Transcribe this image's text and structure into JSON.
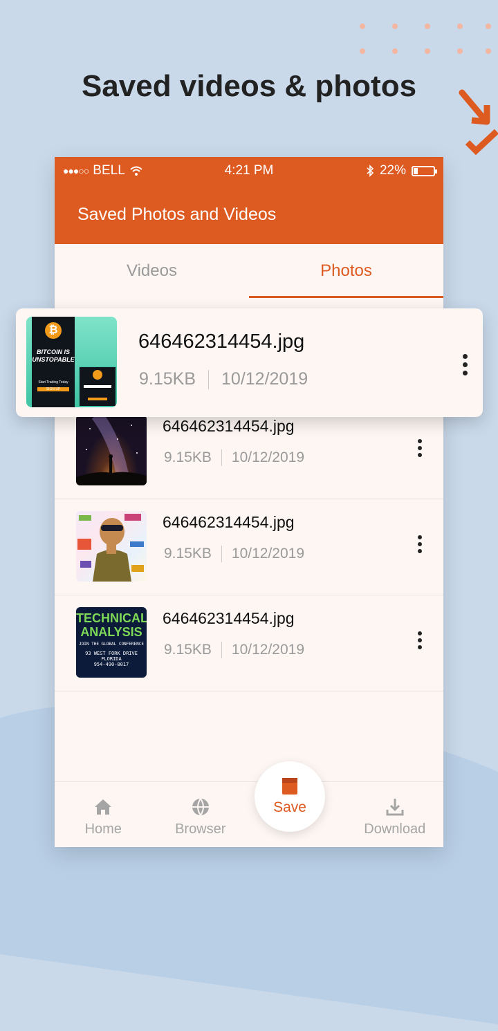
{
  "headline": "Saved videos & photos",
  "status_bar": {
    "carrier": "BELL",
    "time": "4:21 PM",
    "battery": "22%",
    "battery_level": 0.22
  },
  "app_bar": {
    "title": "Saved Photos and Videos"
  },
  "tabs": [
    {
      "label": "Videos",
      "active": false
    },
    {
      "label": "Photos",
      "active": true
    }
  ],
  "featured_item": {
    "filename": "646462314454.jpg",
    "size": "9.15KB",
    "date": "10/12/2019",
    "thumb_text": {
      "title": "BITCOIN IS UNSTOPABLE",
      "sub": "Start Trading Today",
      "btn": "SIGN UP"
    }
  },
  "items": [
    {
      "filename": "646462314454.jpg",
      "size": "9.15KB",
      "date": "10/12/2019",
      "thumb": "night-sky"
    },
    {
      "filename": "646462314454.jpg",
      "size": "9.15KB",
      "date": "10/12/2019",
      "thumb": "collage"
    },
    {
      "filename": "646462314454.jpg",
      "size": "9.15KB",
      "date": "10/12/2019",
      "thumb": "technical-analysis",
      "thumb_text": {
        "title1": "TECHNICAL",
        "title2": "ANALYSIS",
        "line1": "JOIN THE GLOBAL CONFERENCE",
        "line2": "93 WEST FORK DRIVE",
        "line3": "FLORIDA",
        "line4": "954-490-8017"
      }
    }
  ],
  "bottom_nav": {
    "home": "Home",
    "browser": "Browser",
    "save": "Save",
    "download": "Download"
  },
  "colors": {
    "accent": "#dd5a21",
    "background": "#c9d9ea",
    "surface": "#fdf6f2"
  }
}
